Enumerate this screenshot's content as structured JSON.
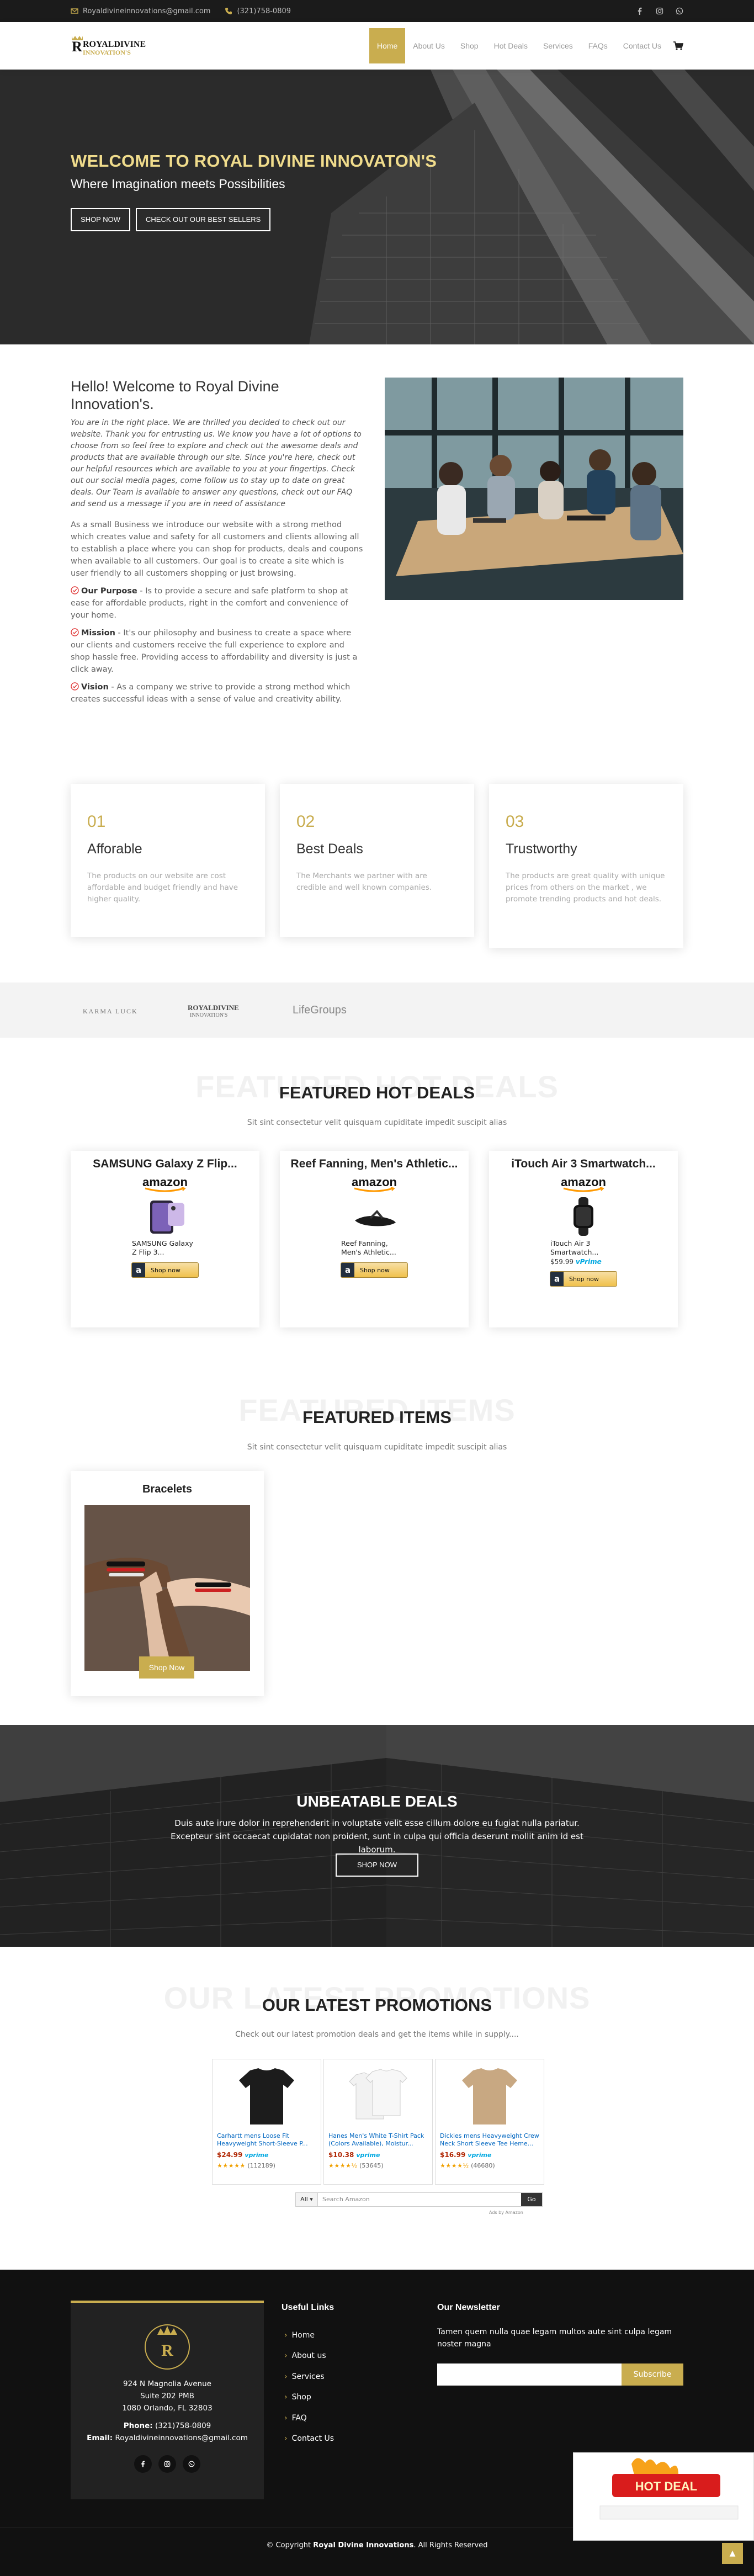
{
  "topbar": {
    "email": "Royaldivineinnovations@gmail.com",
    "phone": "(321)758-0809",
    "social": [
      "facebook-icon",
      "instagram-icon",
      "whatsapp-icon"
    ]
  },
  "brand": {
    "logo_line1": "ROYALDIVINE",
    "logo_line2": "INNOVATION'S",
    "gold": "#c9ad4f"
  },
  "nav": {
    "items": [
      "Home",
      "About Us",
      "Shop",
      "Hot Deals",
      "Services",
      "FAQs",
      "Contact Us"
    ],
    "active": "Home",
    "cart_icon": "cart-icon"
  },
  "hero": {
    "title": "WELCOME TO ROYAL DIVINE INNOVATON'S",
    "subtitle": "Where Imagination meets Possibilities",
    "btn_shop": "SHOP NOW",
    "btn_best": "CHECK OUT OUR BEST SELLERS"
  },
  "about": {
    "title": "Hello! Welcome to Royal Divine Innovation's.",
    "intro": "You are in the right place. We are thrilled you decided to check out our website. Thank you for entrusting us. We know you have a lot of options to choose from so feel free to explore and check out the awesome deals and products that are available through our site. Since you're here, check out our helpful resources which are available to you at your fingertips. Check out our social media pages, come follow us to stay up to date on great deals. Our Team is available to answer any questions, check out our FAQ and send us a message if you are in need of assistance",
    "body": "As a small Business we introduce our website with a strong method which creates value and safety for all customers and clients allowing all to establish a place where you can shop for products, deals and coupons when available to all customers. Our goal is to create a site which is user friendly to all customers shopping or just browsing.",
    "points": [
      {
        "label": "Our Purpose",
        "text": " - Is to provide a secure and safe platform to shop at ease for affordable products, right in the comfort and convenience of your home."
      },
      {
        "label": "Mission",
        "text": " - It's our philosophy and business to create a space where our clients and customers receive the full experience to explore and shop hassle free. Providing access to affordability and diversity is just a click away."
      },
      {
        "label": "Vision",
        "text": " - As a company we strive to provide a strong method which creates successful ideas with a sense of value and creativity ability."
      }
    ]
  },
  "features": [
    {
      "num": "01",
      "title": "Afforable",
      "desc": "The products on our website are cost affordable and budget friendly and have higher quality."
    },
    {
      "num": "02",
      "title": "Best Deals",
      "desc": "The Merchants we partner with are credible and well known companies."
    },
    {
      "num": "03",
      "title": "Trustworthy",
      "desc": "The products are great quality with unique prices from others on the market , we promote trending products and hot deals."
    }
  ],
  "clients": [
    "KARMA LUCK",
    "ROYALDIVINE INNOVATION'S",
    "LifeGroups"
  ],
  "deals": {
    "ghost": "FEATURED HOT DEALS",
    "title": "FEATURED HOT DEALS",
    "subtitle": "Sit sint consectetur velit quisquam cupiditate impedit suscipit alias",
    "amazon": "amazon",
    "shop_label": "Shop now",
    "items": [
      {
        "title": "SAMSUNG Galaxy Z Flip...",
        "name": "SAMSUNG Galaxy Z Flip 3...",
        "price": ""
      },
      {
        "title": "Reef Fanning, Men's Athletic...",
        "name": "Reef Fanning, Men's Athletic...",
        "price": ""
      },
      {
        "title": "iTouch Air 3 Smartwatch...",
        "name": "iTouch Air 3 Smartwatch...",
        "price": "$59.99",
        "prime": "vPrime"
      }
    ]
  },
  "items_section": {
    "ghost": "FEATURED ITEMS",
    "title": "FEATURED ITEMS",
    "subtitle": "Sit sint consectetur velit quisquam cupiditate impedit suscipit alias",
    "card_title": "Bracelets",
    "card_btn": "Shop Now"
  },
  "banner": {
    "title": "UNBEATABLE DEALS",
    "text": "Duis aute irure dolor in reprehenderit in voluptate velit esse cillum dolore eu fugiat nulla pariatur. Excepteur sint occaecat cupidatat non proident, sunt in culpa qui officia deserunt mollit anim id est laborum.",
    "btn": "SHOP NOW"
  },
  "promotions": {
    "ghost": "OUR LATEST PROMOTIONS",
    "title": "OUR LATEST PROMOTIONS",
    "subtitle": "Check out our latest promotion deals and get the items while in supply....",
    "products": [
      {
        "name": "Carhartt mens Loose Fit Heavyweight Short-Sleeve P...",
        "price": "$24.99",
        "prime": "vprime",
        "stars": "★★★★★",
        "reviews": "(112189)"
      },
      {
        "name": "Hanes Men's White T-Shirt Pack (Colors Available), Moistur...",
        "price": "$10.38",
        "prime": "vprime",
        "stars": "★★★★½",
        "reviews": "(53645)"
      },
      {
        "name": "Dickies mens Heavyweight Crew Neck Short Sleeve Tee Heme...",
        "price": "$16.99",
        "prime": "vprime",
        "stars": "★★★★½",
        "reviews": "(46680)"
      }
    ],
    "search_all": "All ▾",
    "search_placeholder": "Search Amazon",
    "search_go": "Go",
    "ads_by": "Ads by Amazon"
  },
  "footer": {
    "address1": "924 N Magnolia Avenue",
    "address2": "Suite 202 PMB",
    "address3": "1080 Orlando, FL 32803",
    "phone_label": "Phone:",
    "phone": "(321)758-0809",
    "email_label": "Email:",
    "email": "Royaldivineinnovations@gmail.com",
    "links_title": "Useful Links",
    "links": [
      "Home",
      "About us",
      "Services",
      "Shop",
      "FAQ",
      "Contact Us"
    ],
    "newsletter_title": "Our Newsletter",
    "newsletter_text": "Tamen quem nulla quae legam multos aute sint culpa legam noster magna",
    "subscribe": "Subscribe",
    "copy_prefix": "© Copyright ",
    "copy_brand": "Royal Divine Innovations",
    "copy_suffix": ". All Rights Reserved",
    "hot_deal_badge": "HOT DEAL",
    "to_top": "▲"
  }
}
